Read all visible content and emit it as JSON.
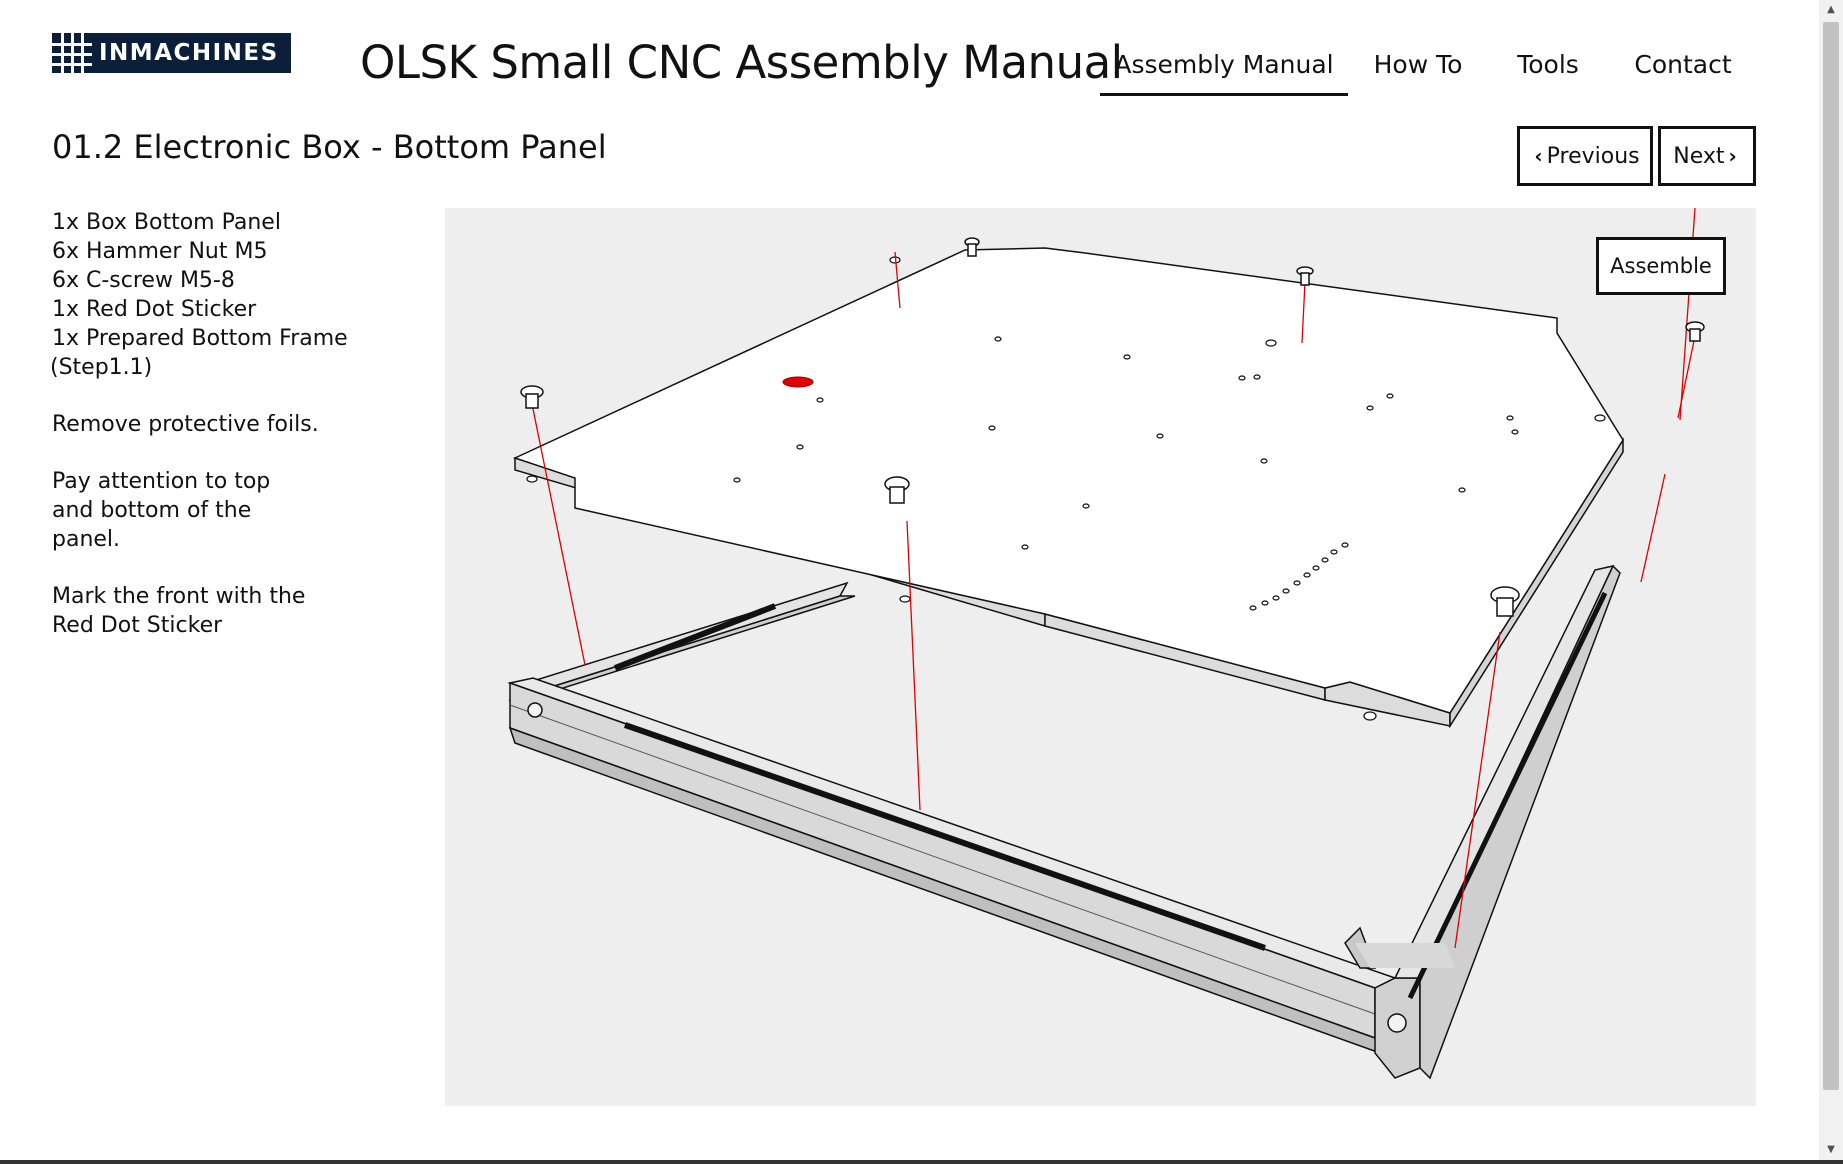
{
  "header": {
    "logo_text": "INMACHINES",
    "site_title": "OLSK Small CNC Assembly Manual",
    "nav": [
      {
        "label": "Assembly Manual",
        "active": true
      },
      {
        "label": "How To",
        "active": false
      },
      {
        "label": "Tools",
        "active": false
      },
      {
        "label": "Contact",
        "active": false
      }
    ]
  },
  "step": {
    "title": "01.2 Electronic Box - Bottom Panel",
    "previous_label": "Previous",
    "next_label": "Next",
    "parts": [
      "1x Box Bottom Panel",
      "6x Hammer Nut M5",
      "6x C-screw M5-8",
      "1x Red Dot Sticker",
      "1x Prepared Bottom Frame",
      "(Step1.1)"
    ],
    "notes": [
      "Remove protective foils.",
      "Pay attention to top and bottom of the panel.",
      "Mark the front with the Red Dot Sticker"
    ]
  },
  "viewer": {
    "assemble_label": "Assemble",
    "background_color": "#eeeeee",
    "sticker_color": "#e00000",
    "guide_line_color": "#e00000"
  },
  "icons": {
    "previous": "chevron-left-icon",
    "next": "chevron-right-icon"
  }
}
